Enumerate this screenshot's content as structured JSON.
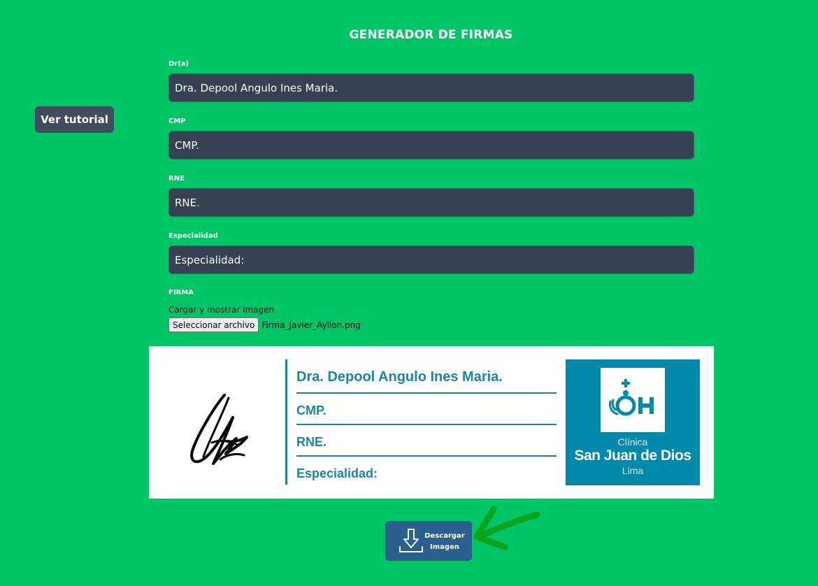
{
  "page": {
    "title": "GENERADOR DE FIRMAS"
  },
  "tutorial": {
    "label": "Ver tutorial"
  },
  "form": {
    "doctor": {
      "label": "Dr(a)",
      "value": "Dra. Depool Angulo Ines Maria."
    },
    "cmp": {
      "label": "CMP",
      "value": "CMP."
    },
    "rne": {
      "label": "RNE",
      "value": "RNE."
    },
    "specialty": {
      "label": "Especialidad",
      "value": "Especialidad:"
    },
    "signature": {
      "label": "FIRMA",
      "caption": "Cargar y mostrar imagen",
      "file_button": "Seleccionar archivo",
      "file_name": "Firma_Javier_Ayllon.png"
    }
  },
  "preview": {
    "name": "Dra. Depool Angulo Ines Maria.",
    "cmp": "CMP.",
    "rne": "RNE.",
    "specialty": "Especialidad:",
    "logo": {
      "line1": "Clínica",
      "line2": "San Juan de Dios",
      "line3": "Lima"
    }
  },
  "download": {
    "line1": "Descargar",
    "line2": "Imagen",
    "icon": "download-icon"
  },
  "colors": {
    "background": "#00c566",
    "input_bg": "#364152",
    "accent": "#1a85a6",
    "logo_bg": "#0089aa",
    "button": "#2b5f8d",
    "arrow": "#0aa51c"
  }
}
